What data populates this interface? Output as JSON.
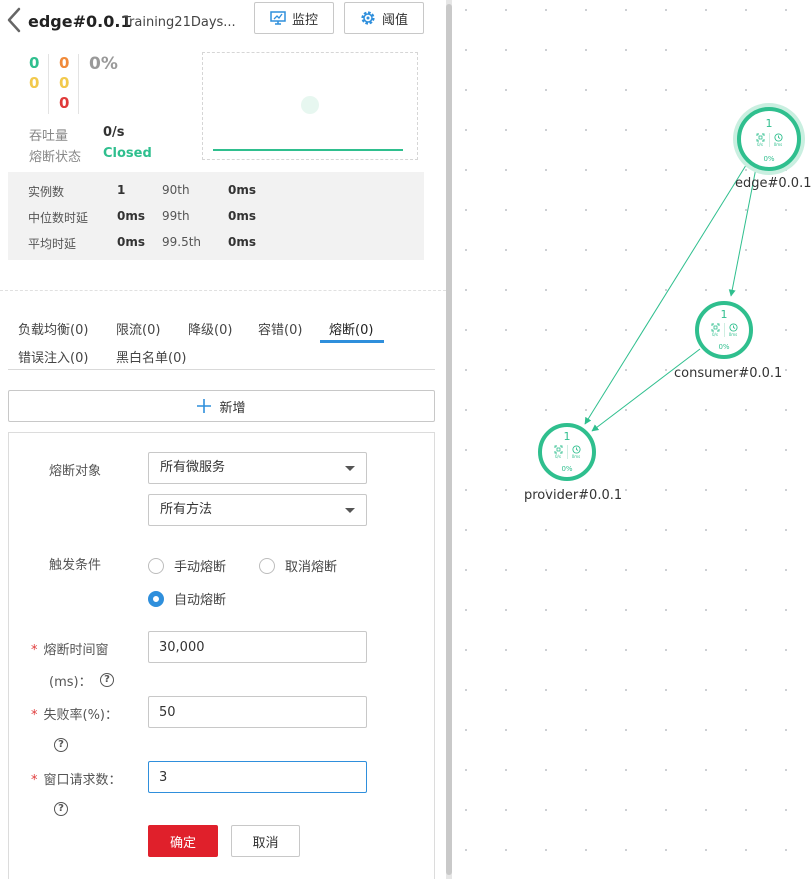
{
  "header": {
    "title": "edge#0.0.1",
    "subtitle": "Training21Days...",
    "monitor_label": "监控",
    "threshold_label": "阈值"
  },
  "stats": {
    "col1": [
      "0",
      "0"
    ],
    "col2": [
      "0",
      "0",
      "0"
    ],
    "percent": "0%",
    "throughput_label": "吞吐量",
    "throughput_value": "0/s",
    "breaker_label": "熔断状态",
    "breaker_value": "Closed",
    "table": {
      "instances_label": "实例数",
      "instances_value": "1",
      "p90_label": "90th",
      "p90_value": "0ms",
      "median_label": "中位数时延",
      "median_value": "0ms",
      "p99_label": "99th",
      "p99_value": "0ms",
      "avg_label": "平均时延",
      "avg_value": "0ms",
      "p995_label": "99.5th",
      "p995_value": "0ms"
    }
  },
  "tabs": [
    {
      "label": "负载均衡(0)"
    },
    {
      "label": "限流(0)"
    },
    {
      "label": "降级(0)"
    },
    {
      "label": "容错(0)"
    },
    {
      "label": "熔断(0)"
    },
    {
      "label": "错误注入(0)"
    },
    {
      "label": "黑白名单(0)"
    }
  ],
  "add_label": "新增",
  "form": {
    "target_label": "熔断对象",
    "service_select": "所有微服务",
    "method_select": "所有方法",
    "trigger_label": "触发条件",
    "radio_manual": "手动熔断",
    "radio_cancel": "取消熔断",
    "radio_auto": "自动熔断",
    "window_label_1": "熔断时间窗",
    "window_label_2": "(ms)：",
    "window_value": "30,000",
    "fail_label": "失败率(%)：",
    "fail_value": "50",
    "req_label": "窗口请求数：",
    "req_value": "3",
    "required_mark": "*",
    "help_mark": "?",
    "ok_label": "确定",
    "cancel_label": "取消"
  },
  "topology": {
    "nodes": [
      {
        "name": "edge#0.0.1",
        "count": "1",
        "left": "0/s",
        "right": "0ms",
        "pct": "0%"
      },
      {
        "name": "consumer#0.0.1",
        "count": "1",
        "left": "0/s",
        "right": "0ms",
        "pct": "0%"
      },
      {
        "name": "provider#0.0.1",
        "count": "1",
        "left": "0/s",
        "right": "0ms",
        "pct": "0%"
      }
    ]
  },
  "colors": {
    "accent": "#2f8fdc",
    "node_green": "#2fbf8e",
    "danger": "#e0202b",
    "stat_green": "#2fbf8e",
    "stat_orange": "#f08a3a",
    "stat_yellow": "#f2c94c",
    "stat_red": "#e03a3a"
  }
}
